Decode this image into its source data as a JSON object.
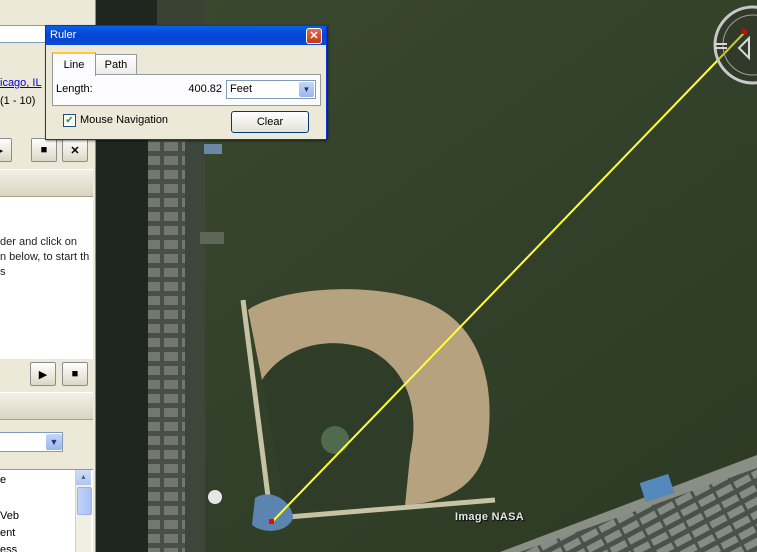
{
  "ruler": {
    "title": "Ruler",
    "close_glyph": "✕",
    "tabs": [
      {
        "label": "Line"
      },
      {
        "label": "Path"
      }
    ],
    "length_label": "Length:",
    "length_value": "400.82",
    "units": "Feet",
    "mouse_navigation_label": "Mouse Navigation",
    "mouse_navigation_checked": true,
    "clear_label": "Clear"
  },
  "sidebar": {
    "location_link": "icago, IL",
    "result_range": "(1 - 10)",
    "tour_text": "der and click on\nn below, to start th\ns",
    "list_items": [
      {
        "label": "e"
      },
      {
        "label": "Veb"
      },
      {
        "label": "ent"
      },
      {
        "label": "ess"
      }
    ]
  },
  "map": {
    "credit": "Image NASA",
    "measure_line_color": "#ffff33",
    "endpoint_color": "#ff0000"
  }
}
